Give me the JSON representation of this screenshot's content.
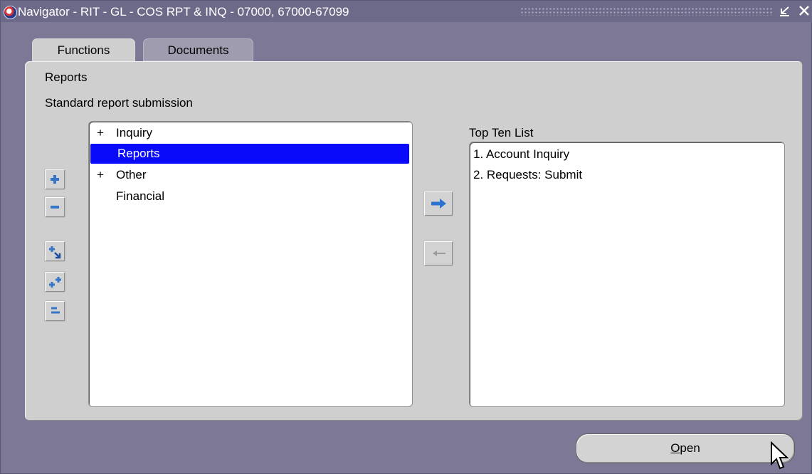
{
  "window": {
    "title": "Navigator - RIT - GL - COS RPT & INQ - 07000, 67000-67099",
    "controls": [
      "minimize-icon",
      "close-icon"
    ],
    "colors": {
      "frame": "#7c7896",
      "panel": "#cfcfcf",
      "selection": "#0a0afa",
      "arrow": "#2c73d1"
    }
  },
  "tabs": [
    {
      "label": "Functions",
      "active": true
    },
    {
      "label": "Documents",
      "active": false
    }
  ],
  "panel": {
    "current_node": "Reports",
    "description": "Standard report submission"
  },
  "function_tree": {
    "items": [
      {
        "prefix": "+",
        "label": "Inquiry",
        "selected": false
      },
      {
        "prefix": "",
        "label": "Reports",
        "selected": true
      },
      {
        "prefix": "+",
        "label": "Other",
        "selected": false
      },
      {
        "prefix": "",
        "label": "Financial",
        "selected": false
      }
    ]
  },
  "top_ten": {
    "label": "Top Ten List",
    "items": [
      "1. Account Inquiry",
      "2. Requests: Submit"
    ]
  },
  "side_buttons": [
    "expand-icon",
    "collapse-icon",
    "expand-branch-icon",
    "expand-all-icon",
    "collapse-all-icon"
  ],
  "arrow_buttons": {
    "add": "right-arrow-icon",
    "remove": "left-arrow-icon"
  },
  "open_button": {
    "mnemonic": "O",
    "rest": "pen"
  }
}
